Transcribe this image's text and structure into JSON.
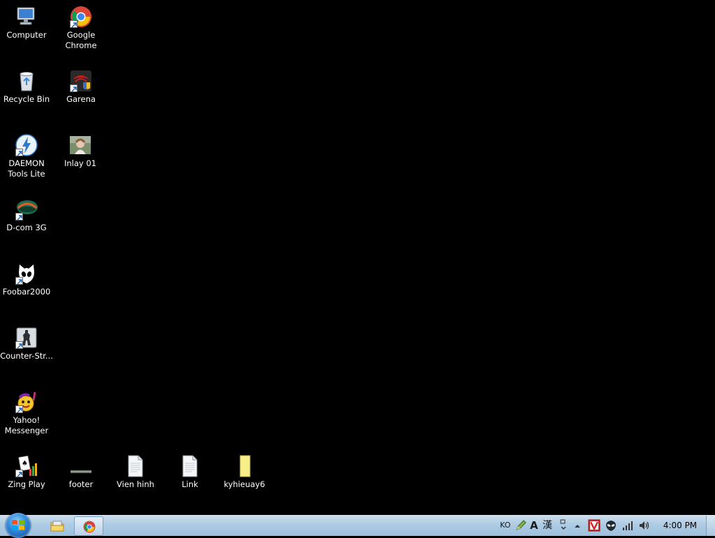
{
  "desktop": {
    "icons": [
      {
        "label": "Computer"
      },
      {
        "label": "Google Chrome"
      },
      {
        "label": "Recycle Bin"
      },
      {
        "label": "Garena"
      },
      {
        "label": "DAEMON Tools Lite"
      },
      {
        "label": "Inlay 01"
      },
      {
        "label": "D-com 3G"
      },
      {
        "label": "Foobar2000"
      },
      {
        "label": "Counter-Str..."
      },
      {
        "label": "Yahoo! Messenger"
      },
      {
        "label": "Zing Play"
      },
      {
        "label": "footer"
      },
      {
        "label": "Vien hinh"
      },
      {
        "label": "Link"
      },
      {
        "label": "kyhieuay6"
      }
    ]
  },
  "taskbar": {
    "pinned": [
      {
        "name": "Windows Explorer",
        "icon": "folder-icon"
      },
      {
        "name": "Google Chrome",
        "icon": "chrome-icon"
      }
    ],
    "tray": {
      "language": "KO",
      "ime_text": "A",
      "ime_hanja": "漢",
      "clock": "4:00 PM"
    }
  },
  "colors": {
    "desktop_background": "#000000",
    "taskbar_top": "#c9dcec",
    "taskbar_bottom": "#9dc0dd"
  }
}
